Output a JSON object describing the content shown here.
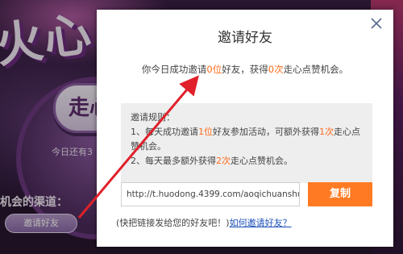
{
  "background": {
    "banner_text": "火心",
    "zan_button_label": "走心",
    "remaining_text": "今日还有3",
    "channel_title": "机会的渠道：",
    "invite_button_label": "邀请好友"
  },
  "dialog": {
    "title": "邀请好友",
    "summary": {
      "prefix": "你今日成功邀请",
      "invited_count": "0位",
      "middle": "好友，获得",
      "chances": "0次",
      "suffix": "走心点赞机会。"
    },
    "rules": {
      "heading": "邀请规则：",
      "rule1": {
        "prefix": "1、每天成功邀请",
        "count": "1位",
        "middle": "好友参加活动，可额外获得",
        "chances": "1次",
        "suffix": "走心点赞机会。"
      },
      "rule2": {
        "prefix": "2、每天最多额外获得",
        "chances": "2次",
        "suffix": "走心点赞机会。"
      }
    },
    "link_value": "http://t.huodong.4399.com/aoqichuanshuo/",
    "copy_button_label": "复制",
    "hint_text": "(快把链接发给您的好友吧！)",
    "how_to_link": "如何邀请好友？"
  },
  "colors": {
    "highlight": "#ff6a1a",
    "copy_button": "#ff7a22",
    "link": "#1a4fb8",
    "annotation_arrow": "#e0202a"
  }
}
